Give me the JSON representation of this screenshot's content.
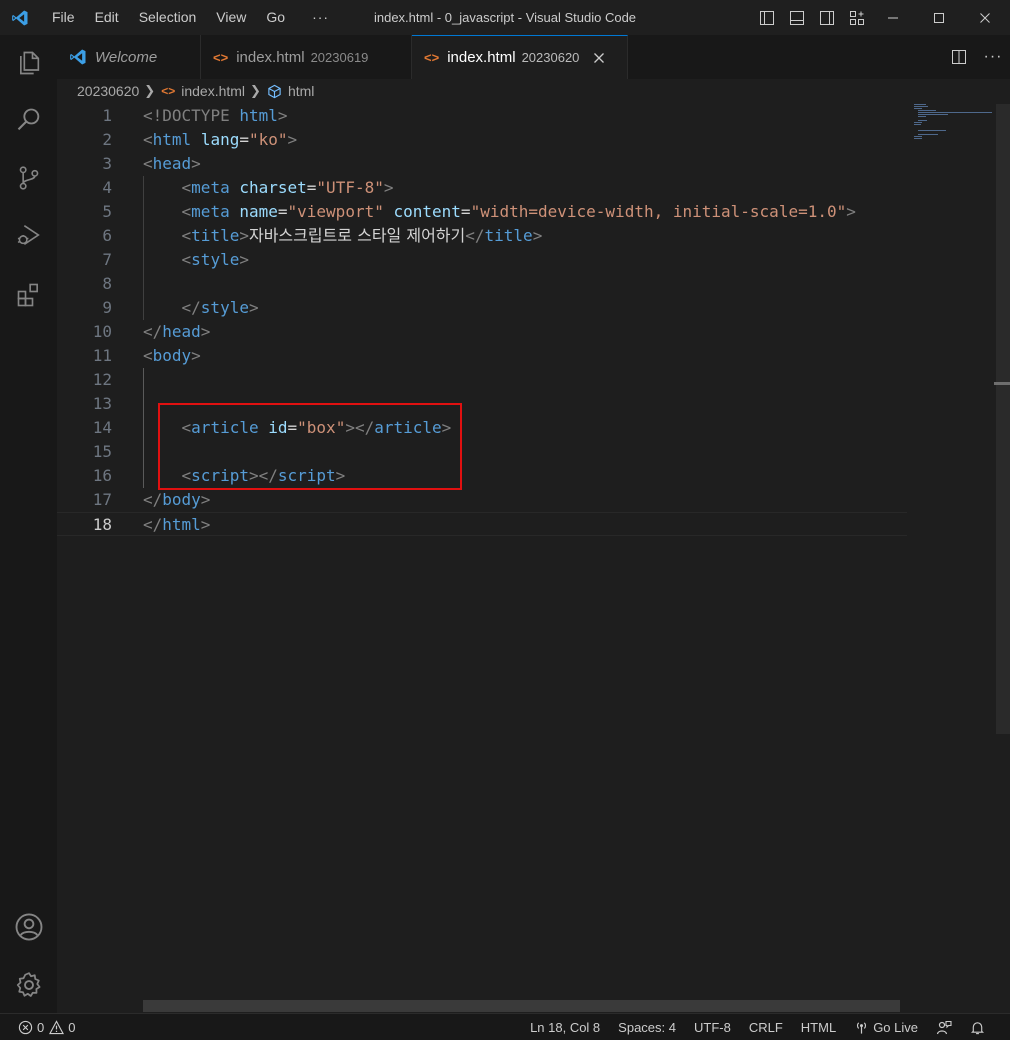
{
  "app": {
    "window_title": "index.html - 0_javascript - Visual Studio Code",
    "menu": [
      "File",
      "Edit",
      "Selection",
      "View",
      "Go",
      "···"
    ]
  },
  "tabs": [
    {
      "label": "Welcome",
      "description": "",
      "icon": "vscode-logo-icon",
      "active": false
    },
    {
      "label": "index.html",
      "description": "20230619",
      "icon": "html-file-icon",
      "active": false
    },
    {
      "label": "index.html",
      "description": "20230620",
      "icon": "html-file-icon",
      "active": true
    }
  ],
  "breadcrumb": {
    "folder": "20230620",
    "file": "index.html",
    "symbol": "html"
  },
  "editor": {
    "lines": [
      {
        "n": "1"
      },
      {
        "n": "2"
      },
      {
        "n": "3"
      },
      {
        "n": "4"
      },
      {
        "n": "5"
      },
      {
        "n": "6"
      },
      {
        "n": "7"
      },
      {
        "n": "8"
      },
      {
        "n": "9"
      },
      {
        "n": "10"
      },
      {
        "n": "11"
      },
      {
        "n": "12"
      },
      {
        "n": "13"
      },
      {
        "n": "14"
      },
      {
        "n": "15"
      },
      {
        "n": "16"
      },
      {
        "n": "17"
      },
      {
        "n": "18"
      }
    ],
    "current_line": "18",
    "tokens": {
      "doctype": "!DOCTYPE",
      "html": "html",
      "lang_attr": "lang",
      "lang_val": "\"ko\"",
      "head": "head",
      "meta": "meta",
      "charset_attr": "charset",
      "charset_val": "\"UTF-8\"",
      "name_attr": "name",
      "name_val": "\"viewport\"",
      "content_attr": "content",
      "content_val": "\"width=device-width, initial-scale=1.0\"",
      "title": "title",
      "title_text": "자바스크립트로 스타일 제어하기",
      "style": "style",
      "body": "body",
      "article": "article",
      "id_attr": "id",
      "id_val": "\"box\"",
      "script": "script"
    }
  },
  "statusbar": {
    "errors": "0",
    "warnings": "0",
    "position": "Ln 18, Col 8",
    "spaces": "Spaces: 4",
    "encoding": "UTF-8",
    "eol": "CRLF",
    "language": "HTML",
    "golive": "Go Live"
  },
  "colors": {
    "accent": "#0078d4",
    "highlight_box": "#e01010",
    "tag": "#569cd6",
    "attribute": "#9cdcfe",
    "string": "#ce9178"
  }
}
